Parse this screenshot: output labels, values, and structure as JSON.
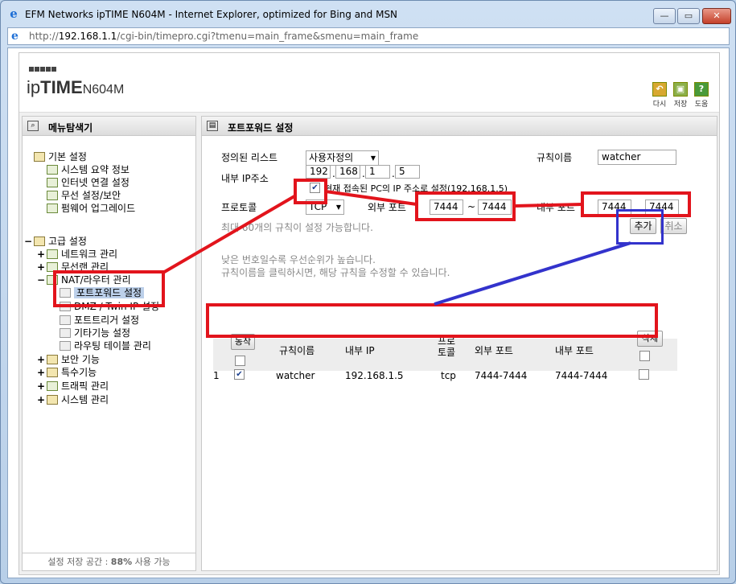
{
  "window": {
    "title": "EFM Networks ipTIME N604M - Internet Explorer, optimized for Bing and MSN",
    "min_glyph": "—",
    "max_glyph": "▭",
    "close_glyph": "✕"
  },
  "address": {
    "scheme": "http://",
    "host": "192.168.1.1",
    "path": "/cgi-bin/timepro.cgi?tmenu=main_frame&smenu=main_frame"
  },
  "header": {
    "logo_prefix": "ip",
    "logo_bold": "TIME",
    "model": "N604M",
    "buttons": [
      {
        "label": "다시",
        "icon": "back-icon",
        "glyph": "↶",
        "color": "#d8a830"
      },
      {
        "label": "저장",
        "icon": "save-icon",
        "glyph": "▣",
        "color": "#8cb04a"
      },
      {
        "label": "도움",
        "icon": "help-icon",
        "glyph": "?",
        "color": "#4a9a3a"
      }
    ]
  },
  "left_menu": {
    "title": "메뉴탐색기",
    "basic": {
      "label": "기본 설정",
      "items": [
        "시스템 요약 정보",
        "인터넷 연결 설정",
        "무선 설정/보안",
        "펌웨어 업그레이드"
      ]
    },
    "advanced": {
      "label": "고급 설정",
      "items": [
        {
          "expander": "+",
          "label": "네트워크 관리"
        },
        {
          "expander": "+",
          "label": "무선랜 관리"
        },
        {
          "expander": "−",
          "label": "NAT/라우터 관리"
        }
      ],
      "nat_items": [
        "포트포워드 설정",
        "DMZ / Twin IP 설정",
        "포트트리거 설정",
        "기타기능 설정",
        "라우팅 테이블 관리"
      ],
      "more": [
        {
          "expander": "+",
          "label": "보안 기능"
        },
        {
          "expander": "+",
          "label": "특수기능"
        },
        {
          "expander": "+",
          "label": "트래픽 관리"
        },
        {
          "expander": "+",
          "label": "시스템 관리"
        }
      ],
      "tree_expander": "−"
    },
    "footer_prefix": "설정 저장 공간 : ",
    "footer_value": "88%",
    "footer_suffix": " 사용 가능"
  },
  "port_forward": {
    "title": "포트포워드 설정",
    "defined_list_label": "정의된 리스트",
    "defined_list_value": "사용자정의",
    "rule_name_label": "규칙이름",
    "rule_name_value": "watcher",
    "internal_ip_label": "내부 IP주소",
    "ip_octets": [
      "192",
      "168",
      "1",
      "5"
    ],
    "ip_dot": ".",
    "current_pc_checkbox_label": "현재 접속된 PC의 IP 주소로 설정(192.168.1.5)",
    "current_pc_checked": true,
    "protocol_label": "프로토콜",
    "protocol_value": "TCP",
    "external_port_label": "외부 포트",
    "external_port_from": "7444",
    "external_port_to": "7444",
    "range_sep": "~",
    "internal_port_label": "내부 포트",
    "internal_port_from": "7444",
    "internal_port_to": "7444",
    "max_rules_note": "최대 60개의 규칙이 설정 가능합니다.",
    "add_button": "추가",
    "cancel_button": "취소",
    "priority_note": "낮은 번호일수록 우선순위가 높습니다.",
    "edit_note": "규칙이름을 클릭하시면, 해당 규칙을 수정할 수 있습니다.",
    "table": {
      "action_button": "동작",
      "delete_button": "삭제",
      "columns": [
        "규칙이름",
        "내부 IP",
        "프로토콜",
        "외부 포트",
        "내부 포트"
      ],
      "rows": [
        {
          "index": "1",
          "enabled": true,
          "name": "watcher",
          "internal_ip": "192.168.1.5",
          "protocol": "tcp",
          "external_port": "7444-7444",
          "internal_port": "7444-7444",
          "delete": false
        }
      ]
    }
  },
  "annotation_colors": {
    "red": "#e2141c",
    "blue": "#3333cc"
  }
}
